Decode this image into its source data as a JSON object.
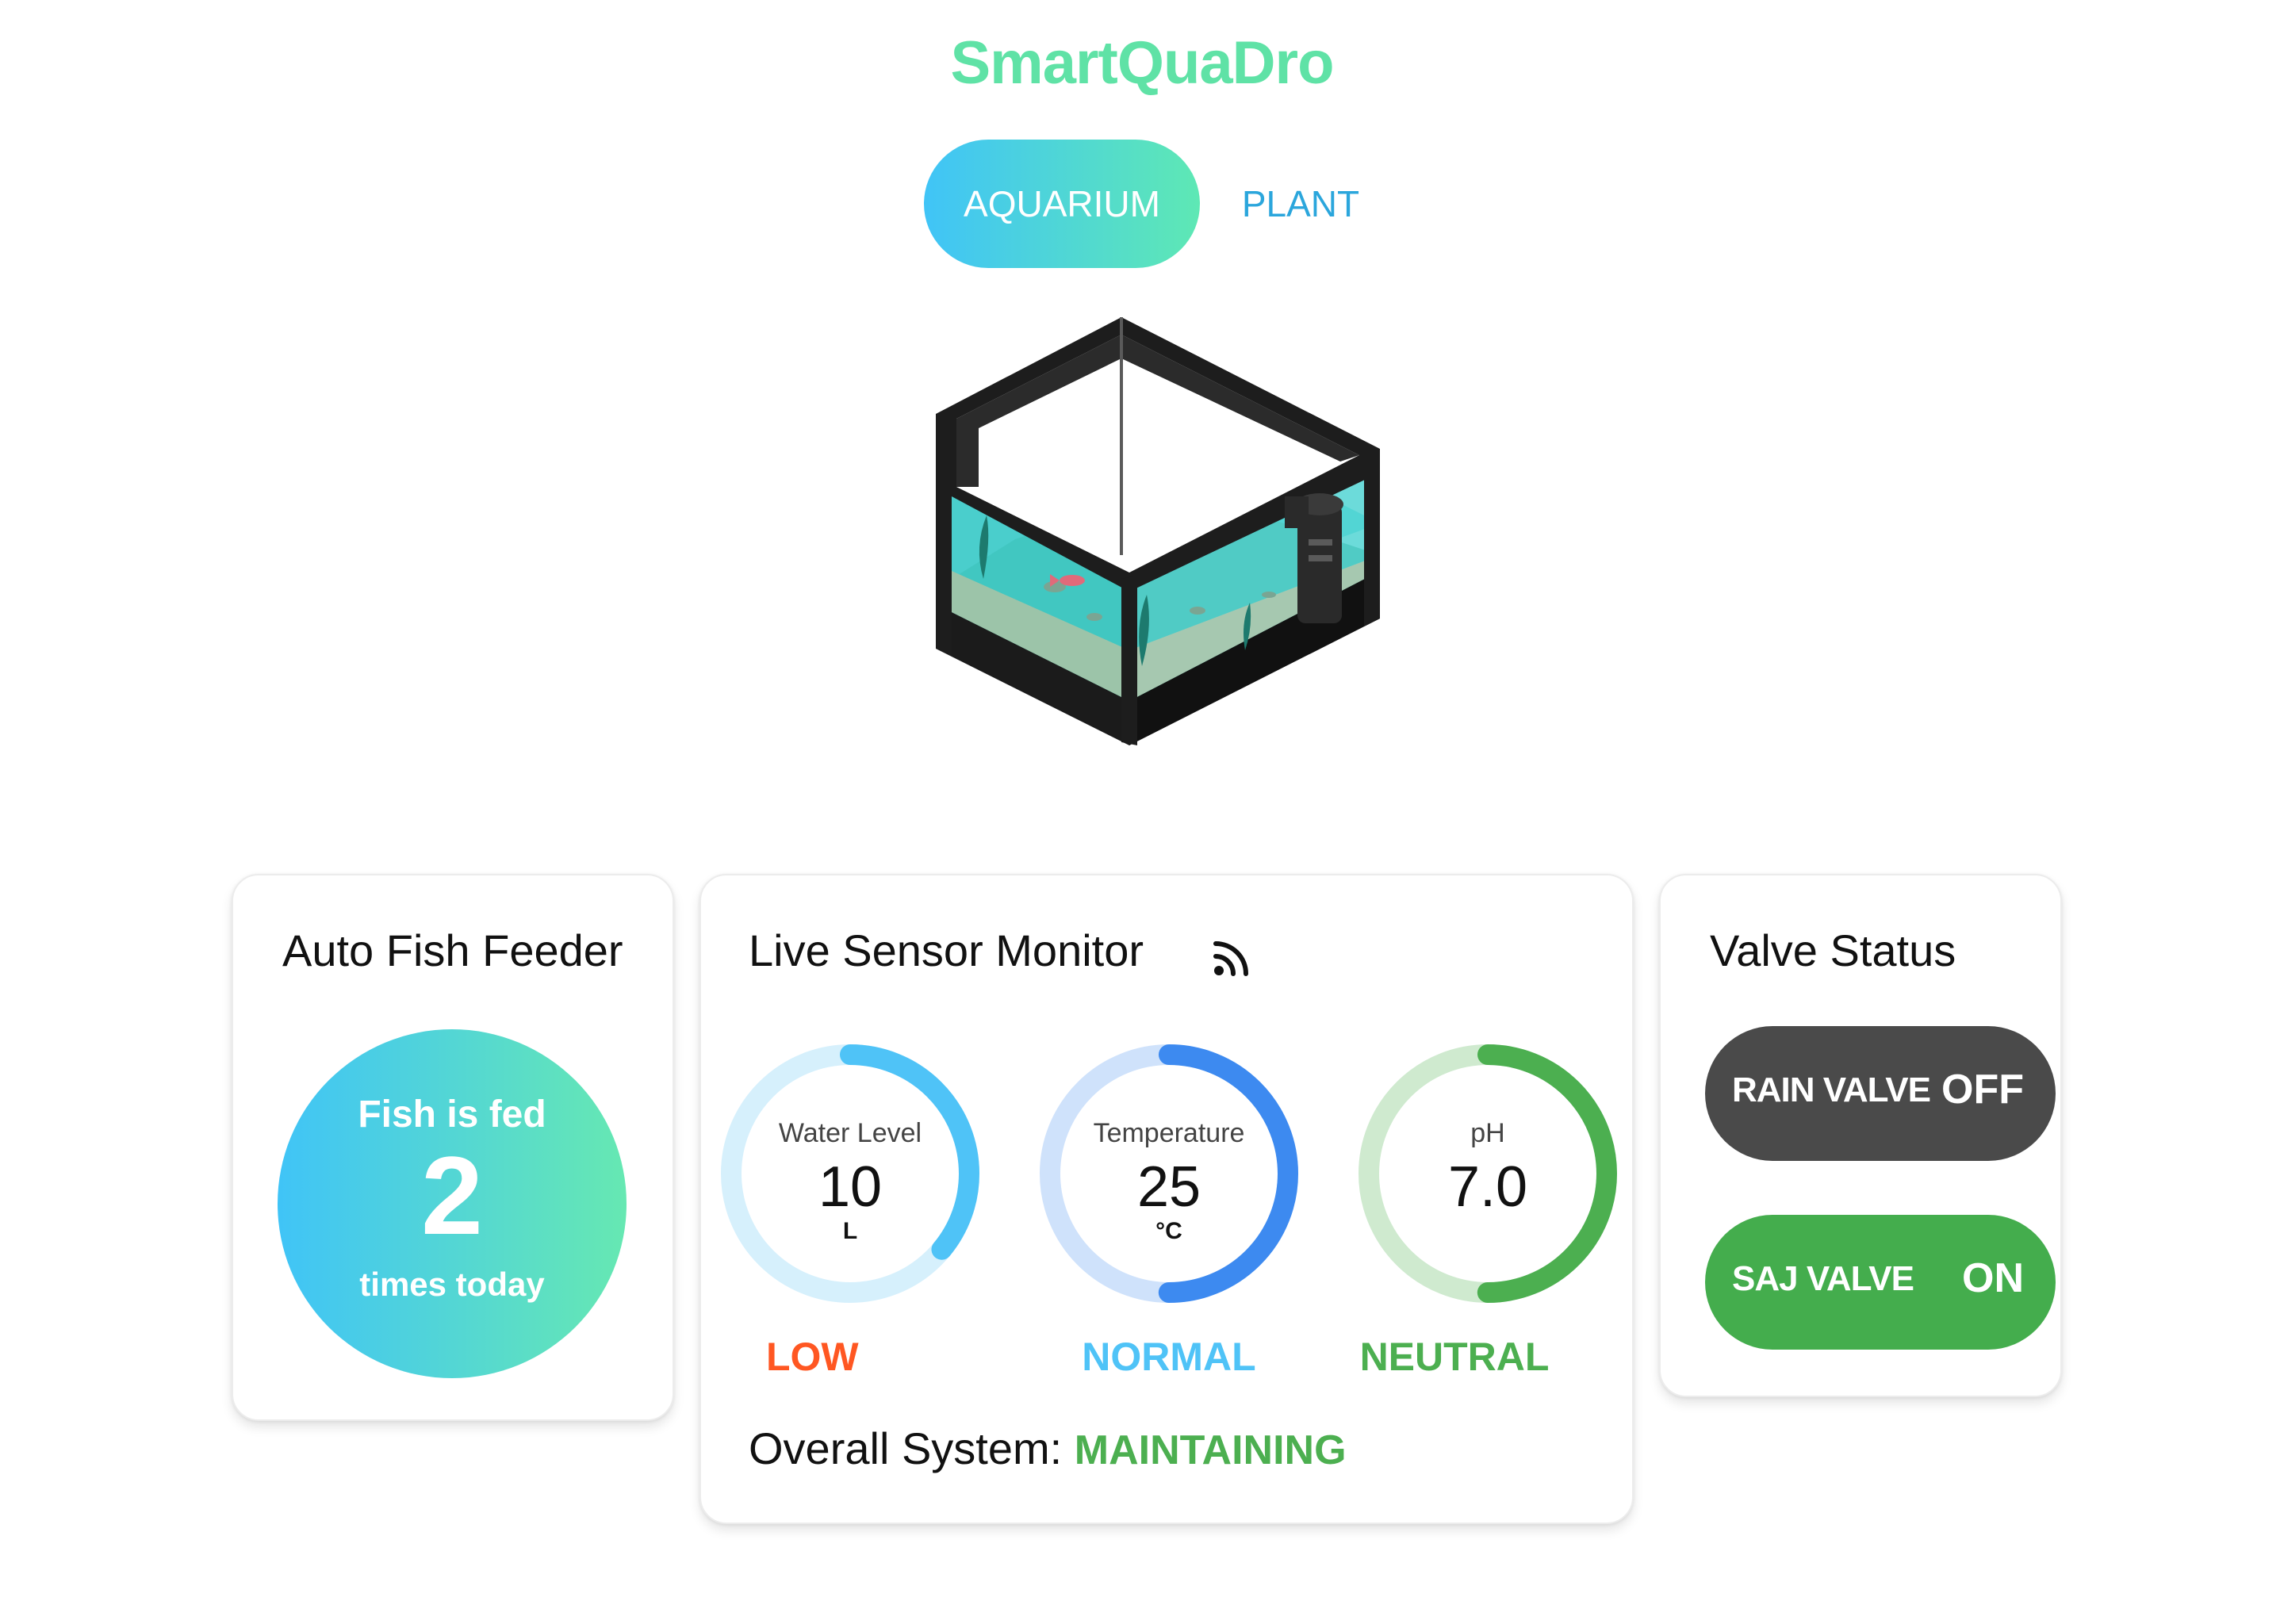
{
  "app": {
    "title": "SmartQuaDro"
  },
  "tabs": [
    {
      "label": "AQUARIUM",
      "active": true
    },
    {
      "label": "PLANT",
      "active": false
    }
  ],
  "colors": {
    "brand_green": "#5fe2a6",
    "gradient_start": "#40c4f7",
    "gradient_end": "#5ee8b4",
    "status_low": "#ff5722",
    "status_normal": "#4fc3f7",
    "status_neutral": "#4caf50",
    "valve_off": "#4a4a4a",
    "valve_on": "#44ad4d"
  },
  "feeder": {
    "title": "Auto Fish Feeder",
    "line1": "Fish is fed",
    "count": "2",
    "line2": "times today"
  },
  "sensor": {
    "title": "Live Sensor Monitor",
    "icon": "rss-feed-icon",
    "gauges": [
      {
        "label": "Water Level",
        "value": "10",
        "unit": "L",
        "status": "LOW",
        "fill_fraction": 0.36,
        "track_color": "#d6f0fc",
        "arc_color": "#4fc3f7",
        "status_color": "#ff5722"
      },
      {
        "label": "Temperature",
        "value": "25",
        "unit": "°C",
        "status": "NORMAL",
        "fill_fraction": 0.5,
        "track_color": "#cfe2fb",
        "arc_color": "#3d8af0",
        "status_color": "#4fc3f7"
      },
      {
        "label": "pH",
        "value": "7.0",
        "unit": "",
        "status": "NEUTRAL",
        "fill_fraction": 0.5,
        "track_color": "#cfeacf",
        "arc_color": "#4caf50",
        "status_color": "#4caf50"
      }
    ],
    "overall_label": "Overall System:",
    "overall_value": "MAINTAINING"
  },
  "valves": {
    "title": "Valve Status",
    "items": [
      {
        "name": "RAIN VALVE",
        "state": "OFF"
      },
      {
        "name": "SAJ VALVE",
        "state": "ON"
      }
    ]
  }
}
